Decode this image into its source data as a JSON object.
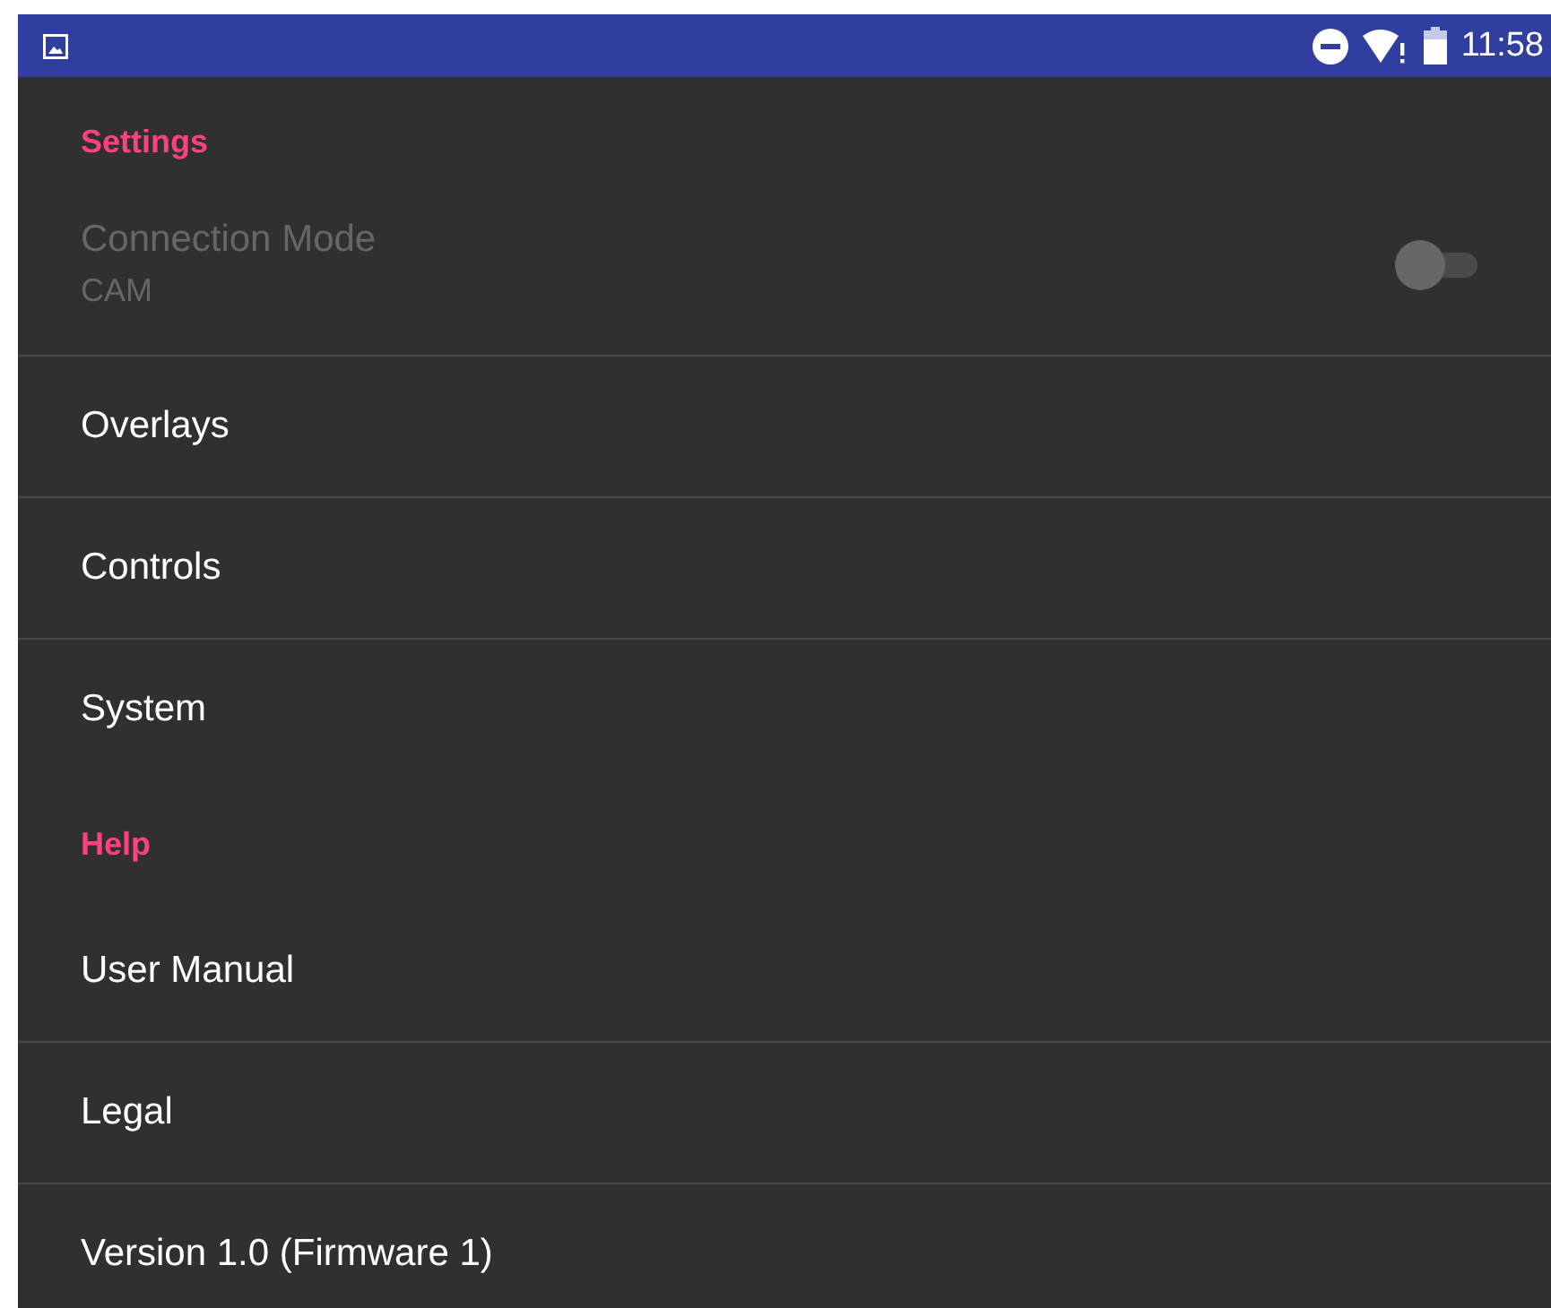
{
  "status_bar": {
    "time": "11:58"
  },
  "list": [
    {
      "kind": "header",
      "label": "Settings"
    },
    {
      "kind": "switch",
      "label": "Connection Mode",
      "summary": "CAM",
      "disabled": true,
      "on": false
    },
    {
      "kind": "item",
      "label": "Overlays"
    },
    {
      "kind": "item",
      "label": "Controls"
    },
    {
      "kind": "item",
      "label": "System",
      "divider": false
    },
    {
      "kind": "header",
      "label": "Help"
    },
    {
      "kind": "item",
      "label": "User Manual"
    },
    {
      "kind": "item",
      "label": "Legal"
    },
    {
      "kind": "item",
      "label": "Version 1.0 (Firmware 1)"
    }
  ]
}
